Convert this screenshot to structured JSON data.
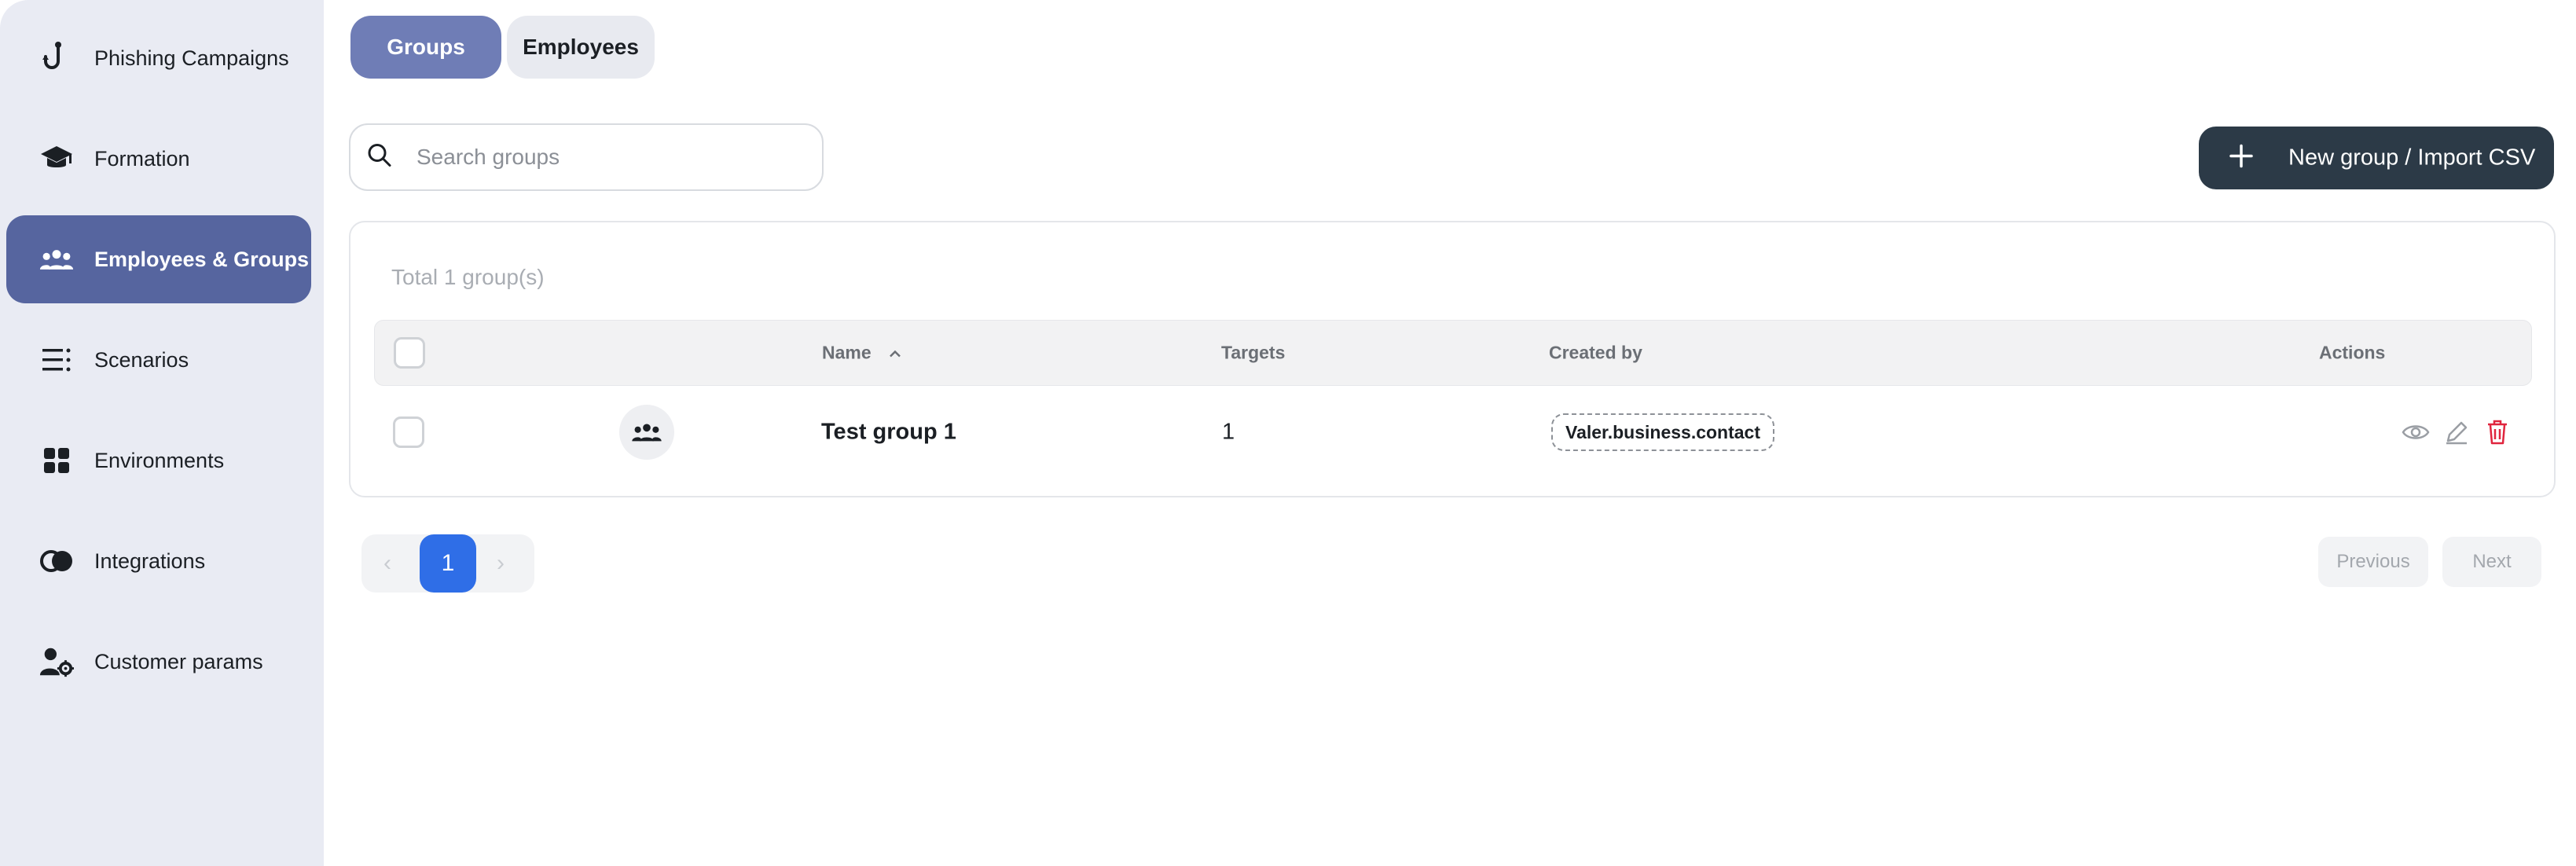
{
  "sidebar": {
    "items": [
      {
        "label": "Phishing Campaigns",
        "icon": "hook-icon",
        "active": false
      },
      {
        "label": "Formation",
        "icon": "graduation-cap-icon",
        "active": false
      },
      {
        "label": "Employees & Groups",
        "icon": "group-icon",
        "active": true
      },
      {
        "label": "Scenarios",
        "icon": "list-icon",
        "active": false
      },
      {
        "label": "Environments",
        "icon": "grid-icon",
        "active": false
      },
      {
        "label": "Integrations",
        "icon": "toggle-circles-icon",
        "active": false
      },
      {
        "label": "Customer params",
        "icon": "user-gear-icon",
        "active": false
      }
    ]
  },
  "tabs": [
    {
      "label": "Groups",
      "active": true
    },
    {
      "label": "Employees",
      "active": false
    }
  ],
  "search": {
    "placeholder": "Search groups",
    "value": ""
  },
  "toolbar": {
    "new_label": "New group / Import CSV"
  },
  "table": {
    "total": "Total 1 group(s)",
    "headers": {
      "name": "Name",
      "targets": "Targets",
      "created_by": "Created by",
      "actions": "Actions"
    },
    "rows": [
      {
        "name": "Test group 1",
        "targets": "1",
        "created_by": "Valer.business.contact"
      }
    ]
  },
  "pagination": {
    "current": "1",
    "previous": "Previous",
    "next": "Next"
  },
  "colors": {
    "accent": "#56659f",
    "primary_button": "#2c3a47",
    "page_active": "#2f6ee7",
    "danger": "#e0253e"
  }
}
